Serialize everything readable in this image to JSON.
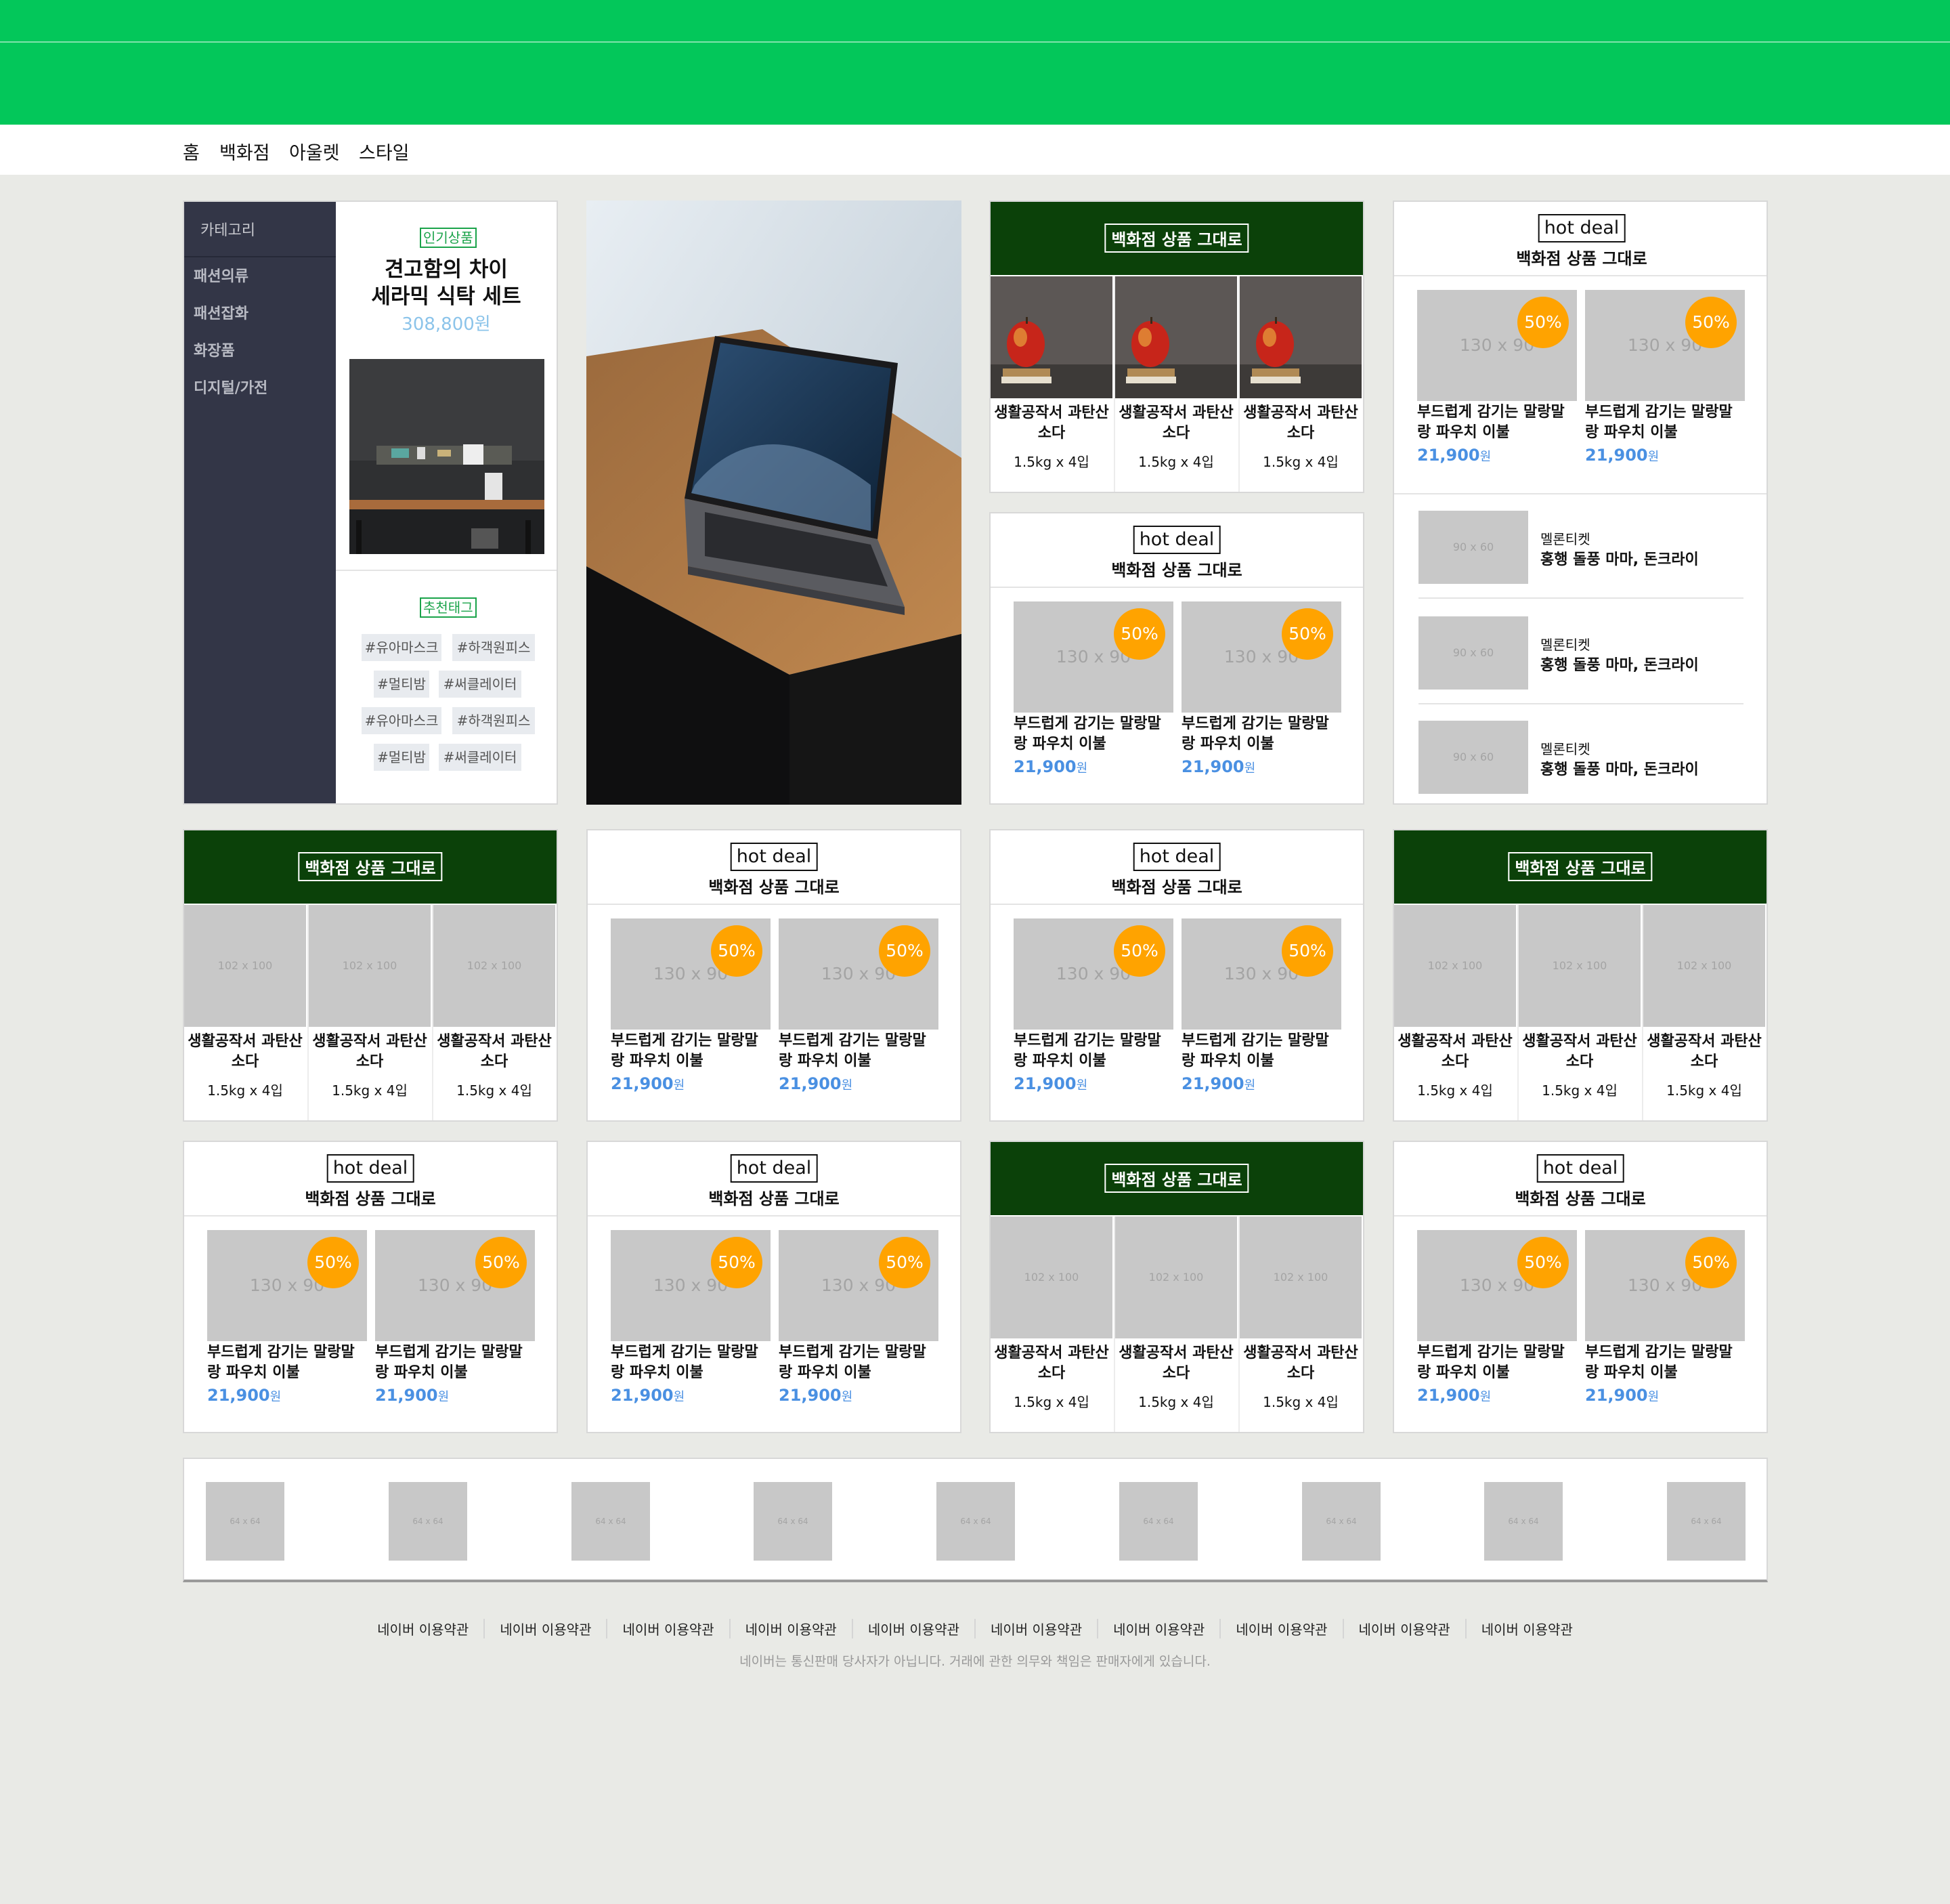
{
  "nav": [
    "홈",
    "백화점",
    "아울렛",
    "스타일"
  ],
  "category": {
    "title": "카테고리",
    "items": [
      "패션의류",
      "패션잡화",
      "화장품",
      "디지털/가전"
    ]
  },
  "popular": {
    "badge": "인기상품",
    "title1": "견고함의 차이",
    "title2": "세라믹 식탁 세트",
    "price": "308,800원"
  },
  "tags": {
    "badge": "추천태그",
    "items": [
      "#유아마스크",
      "#하객원피스",
      "#멀티밤",
      "#써클레이터",
      "#유아마스크",
      "#하객원피스",
      "#멀티밤",
      "#써클레이터"
    ]
  },
  "dept_label": "백화점 상품 그대로",
  "hot_label": "hot deal",
  "hot_sub": "백화점 상품 그대로",
  "product": {
    "name": "생활공작서 과탄산 소다",
    "qty": "1.5kg x 4입"
  },
  "deal": {
    "name": "부드럽게 감기는 말랑말랑 파우치 이불",
    "price": "21,900",
    "unit": "원",
    "percent": "50%",
    "thumb": "130 x 90"
  },
  "thumb102": "102 x 100",
  "mellon": {
    "thumb": "90 x 60",
    "title": "멜론티켓",
    "subtitle": "홍행 돌풍 마마, 돈크라이"
  },
  "logo_thumb": "64 x 64",
  "footer": {
    "links": [
      "네이버 이용약관",
      "네이버 이용약관",
      "네이버 이용약관",
      "네이버 이용약관",
      "네이버 이용약관",
      "네이버 이용약관",
      "네이버 이용약관",
      "네이버 이용약관",
      "네이버 이용약관",
      "네이버 이용약관"
    ],
    "notice": "네이버는 통신판매 당사자가 아닙니다. 거래에 관한 의무와 책임은 판매자에게 있습니다."
  },
  "colors": {
    "brand": "#03c75a",
    "dept_header": "#0b4109",
    "badge": "#ffa300",
    "price": "#4a90e2",
    "sidebar": "#333647"
  }
}
